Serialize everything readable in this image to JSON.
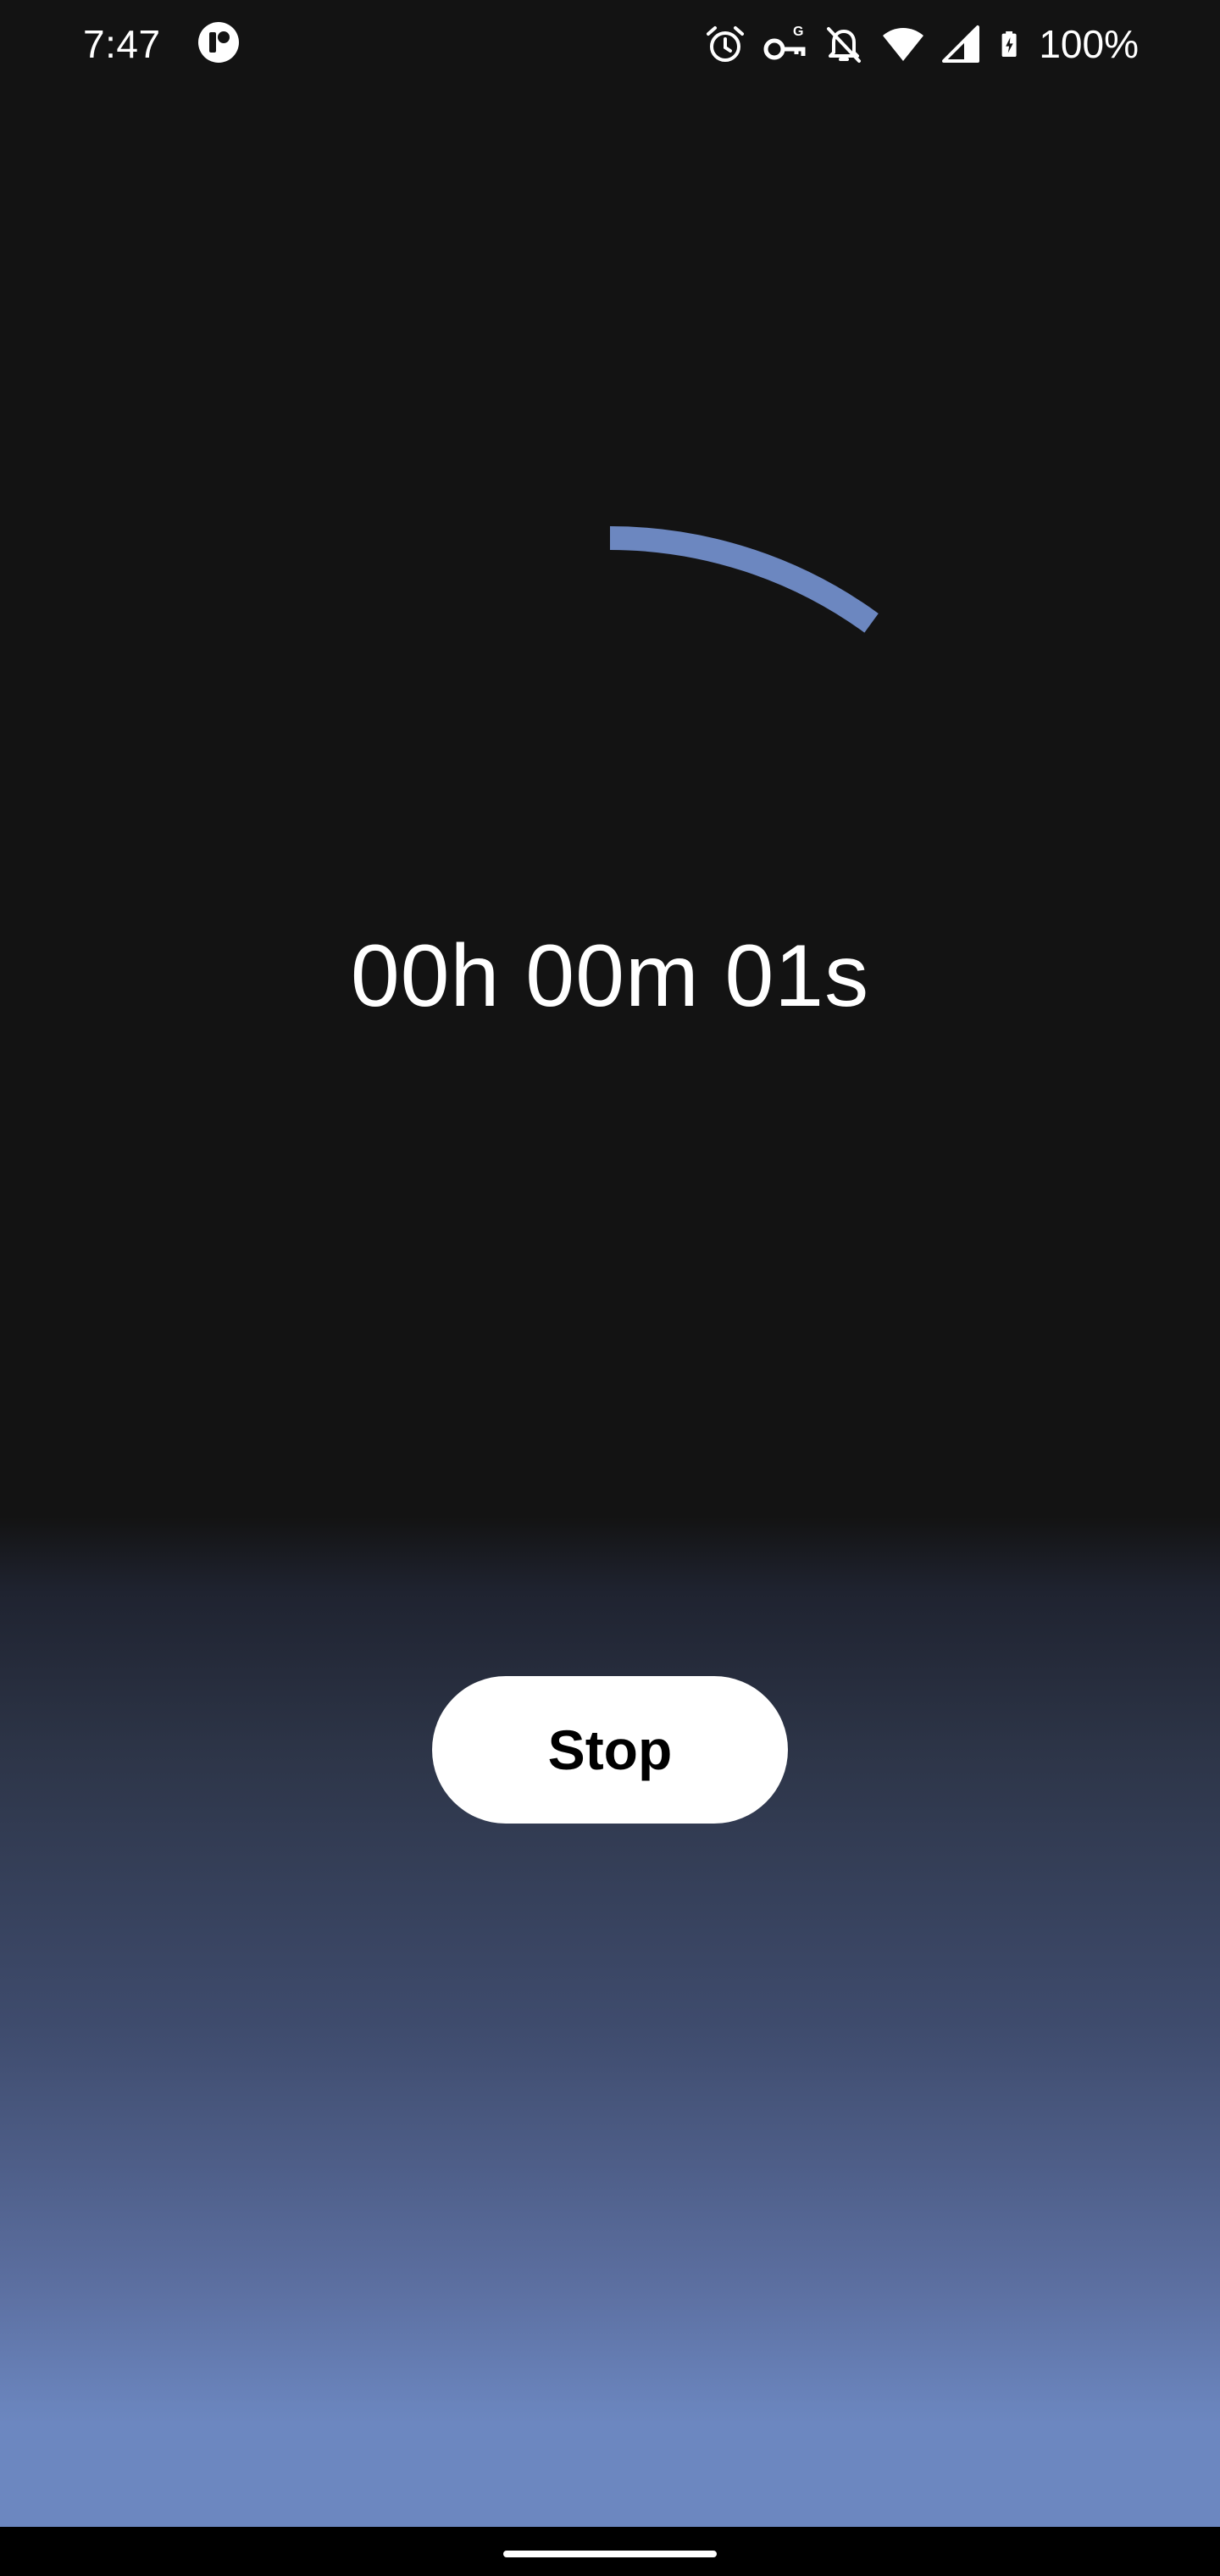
{
  "status_bar": {
    "time": "7:47",
    "battery_percent": "100%",
    "icons": [
      "app-notification-icon",
      "alarm-icon",
      "vpn-key-icon",
      "notifications-off-icon",
      "wifi-icon",
      "cellular-signal-icon",
      "battery-charging-icon"
    ]
  },
  "timer": {
    "elapsed": "00h 00m 01s",
    "progress_fraction": 0.1,
    "progress_color": "#6c87c0"
  },
  "actions": {
    "stop_label": "Stop"
  },
  "colors": {
    "background": "#131313",
    "gradient_bottom": "#6c87c0",
    "button_background": "#ffffff",
    "text": "#ffffff"
  }
}
